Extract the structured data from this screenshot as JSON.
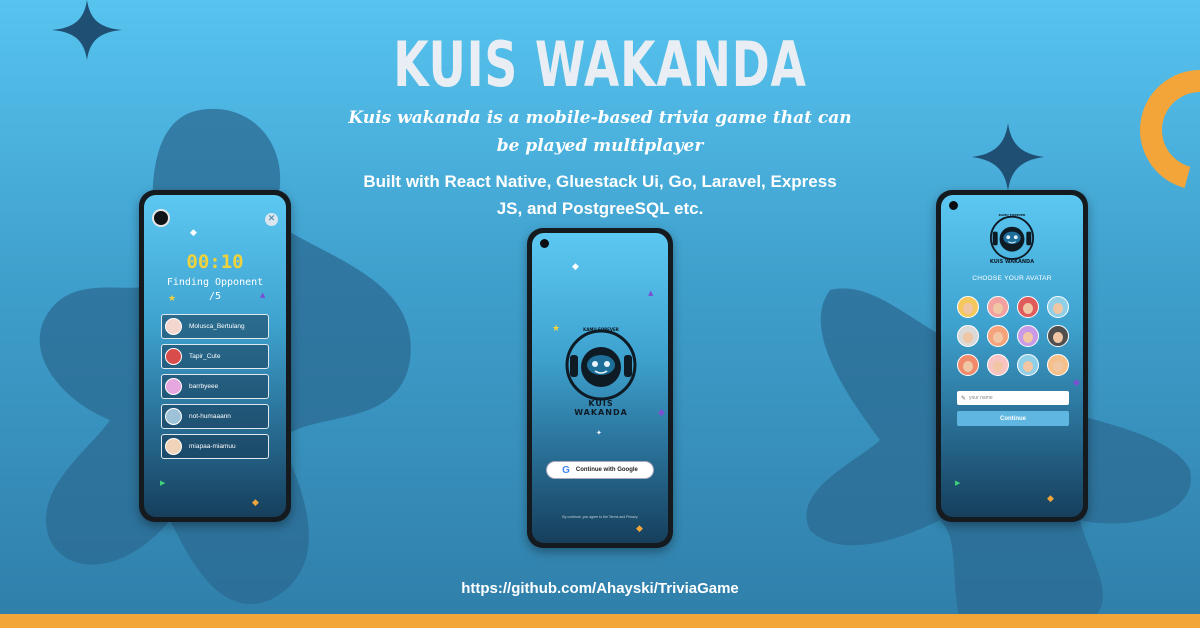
{
  "page": {
    "title": "KUIS WAKANDA",
    "subtitle": "Kuis wakanda is a mobile-based trivia game that can be played multiplayer",
    "built_with": "Built with React Native, Gluestack Ui, Go, Laravel, Express JS, and PostgreeSQL etc.",
    "repo_url": "https://github.com/Ahayski/TriviaGame"
  },
  "colors": {
    "background_top": "#57c3ef",
    "background_bottom": "#2f7ea9",
    "accent_orange": "#f4a53a",
    "timer_yellow": "#f0d33b",
    "blob_dark": "#2b6b93"
  },
  "phone_matchmaking": {
    "timer": "00:10",
    "status": "Finding Opponent",
    "count": "/5",
    "close_icon": "close-icon",
    "players": [
      {
        "name": "Molusca_Bertulang",
        "avatar_color": "#f3d6cd"
      },
      {
        "name": "Tapir_Cute",
        "avatar_color": "#d94c4c"
      },
      {
        "name": "barrbyeee",
        "avatar_color": "#e6a6e0"
      },
      {
        "name": "not-humaaann",
        "avatar_color": "#9ec3d9"
      },
      {
        "name": "miapaa-miamuu",
        "avatar_color": "#f0d3b8"
      }
    ]
  },
  "phone_login": {
    "logo_top_text": "KAMU FOREVER",
    "logo_bottom_text": "KUIS WAKANDA",
    "google_button": "Continue with Google",
    "terms": "By continue, you agree to the Terms and Privacy"
  },
  "phone_avatar": {
    "logo_top_text": "KAMU FOREVER",
    "logo_bottom_text": "KUIS WAKANDA",
    "heading": "CHOOSE YOUR AVATAR",
    "avatars": [
      "#f6c75d",
      "#f2a0a0",
      "#e05b5b",
      "#8fd0e8",
      "#d9d9d9",
      "#f6a27a",
      "#c89ae8",
      "#4f4f4f",
      "#f08a6a",
      "#f7c3c3",
      "#8fd0e8",
      "#f5c08a"
    ],
    "name_placeholder": "your name",
    "continue_button": "Continue"
  }
}
